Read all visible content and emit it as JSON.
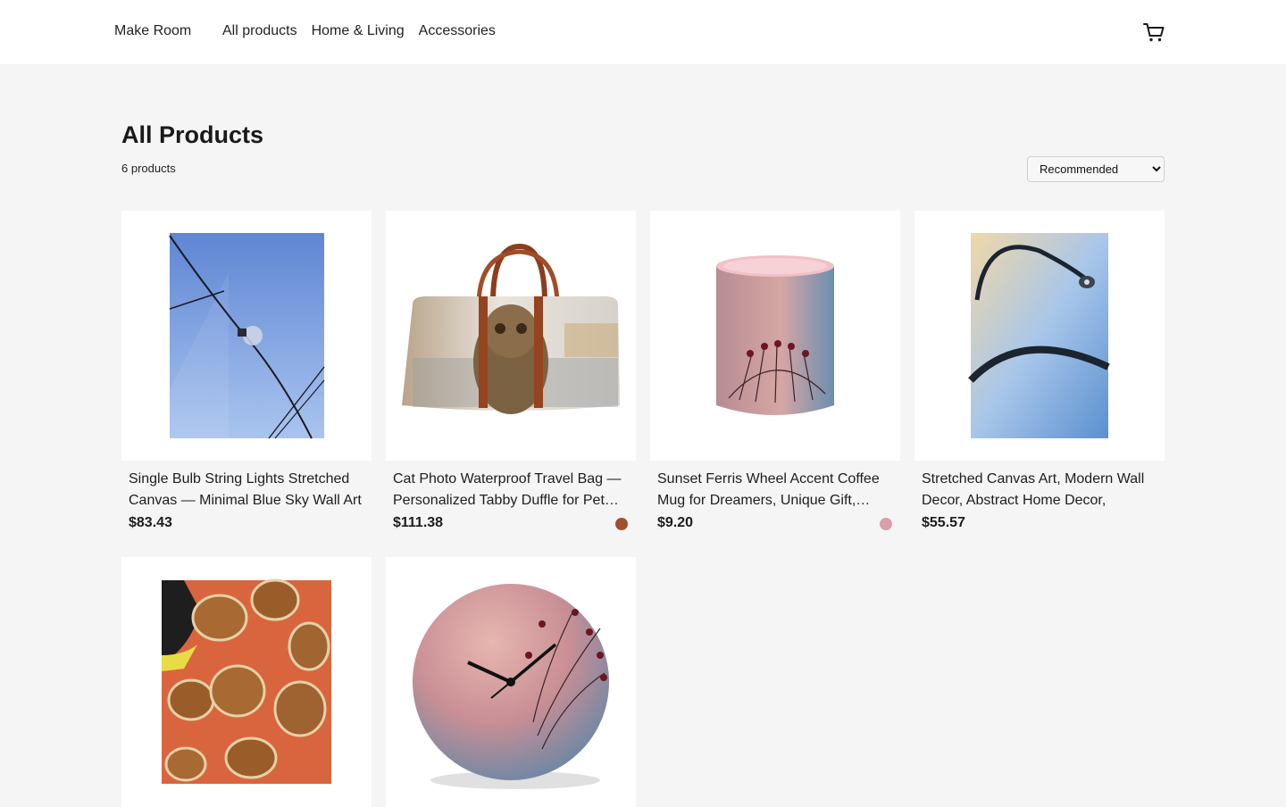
{
  "header": {
    "brand": "Make Room",
    "nav": [
      "All products",
      "Home & Living",
      "Accessories"
    ],
    "cart_icon": "cart-icon"
  },
  "main": {
    "title": "All Products",
    "count_text": "6 products",
    "sort": {
      "selected": "Recommended",
      "options": [
        "Recommended"
      ]
    }
  },
  "products": [
    {
      "title": "Single Bulb String Lights Stretched Canvas — Minimal Blue Sky Wall Art",
      "price": "$83.43"
    },
    {
      "title": "Cat Photo Waterproof Travel Bag — Personalized Tabby Duffle for Pet…",
      "price": "$111.38",
      "swatch_color": "#a0502e"
    },
    {
      "title": "Sunset Ferris Wheel Accent Coffee Mug for Dreamers, Unique Gift,…",
      "price": "$9.20",
      "swatch_color": "#d9a0a8"
    },
    {
      "title": "Stretched Canvas Art, Modern Wall Decor, Abstract Home Decor, Unique…",
      "price": "$55.57"
    },
    {
      "title": "",
      "price": ""
    },
    {
      "title": "",
      "price": ""
    }
  ]
}
